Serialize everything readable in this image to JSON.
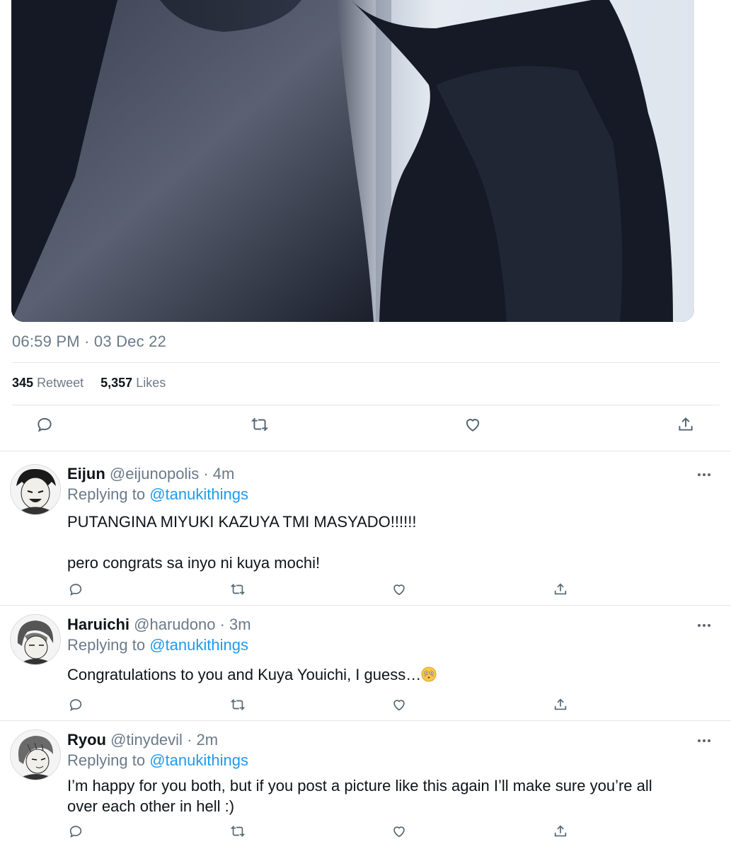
{
  "tweet": {
    "timestamp": "06:59 PM · 03 Dec 22",
    "retweet_count": "345",
    "retweet_label": "Retweet",
    "likes_count": "5,357",
    "likes_label": "Likes"
  },
  "action_icons": [
    "reply-icon",
    "retweet-icon",
    "like-icon",
    "share-icon"
  ],
  "replies": [
    {
      "name": "Eijun",
      "handle": "@eijunopolis",
      "time": "· 4m",
      "replying_label": "Replying to",
      "replying_to": "@tanukithings",
      "text_lines": [
        "PUTANGINA MIYUKI KAZUYA TMI MASYADO!!!!!!",
        "pero congrats sa inyo ni kuya mochi!"
      ]
    },
    {
      "name": "Haruichi",
      "handle": "@harudono",
      "time": "· 3m",
      "replying_label": "Replying to",
      "replying_to": "@tanukithings",
      "text_lines": [
        "Congratulations to you and Kuya Youichi, I guess…"
      ],
      "emoji": "flushed-face"
    },
    {
      "name": "Ryou",
      "handle": "@tinydevil",
      "time": "· 2m",
      "replying_label": "Replying to",
      "replying_to": "@tanukithings",
      "text_lines": [
        "I’m happy for you both, but if you post a picture like this again I’ll make sure you’re all over each other in hell :)"
      ]
    }
  ],
  "colors": {
    "accent": "#1d9bf0",
    "muted": "#6b7a88",
    "divider": "#e1e6ea"
  }
}
